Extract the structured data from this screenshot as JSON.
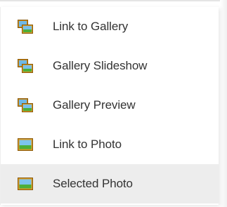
{
  "menu": {
    "items": [
      {
        "label": "Link to Gallery",
        "icon": "gallery-icon",
        "selected": false
      },
      {
        "label": "Gallery Slideshow",
        "icon": "gallery-icon",
        "selected": false
      },
      {
        "label": "Gallery Preview",
        "icon": "gallery-icon",
        "selected": false
      },
      {
        "label": "Link to Photo",
        "icon": "photo-icon",
        "selected": false
      },
      {
        "label": "Selected Photo",
        "icon": "photo-icon",
        "selected": true
      }
    ]
  },
  "colors": {
    "selected_background": "#ededed",
    "text": "#333333",
    "icon_frame": "#c88a1c",
    "icon_sky": "#6fb8e6",
    "icon_grass": "#4caf3a"
  }
}
